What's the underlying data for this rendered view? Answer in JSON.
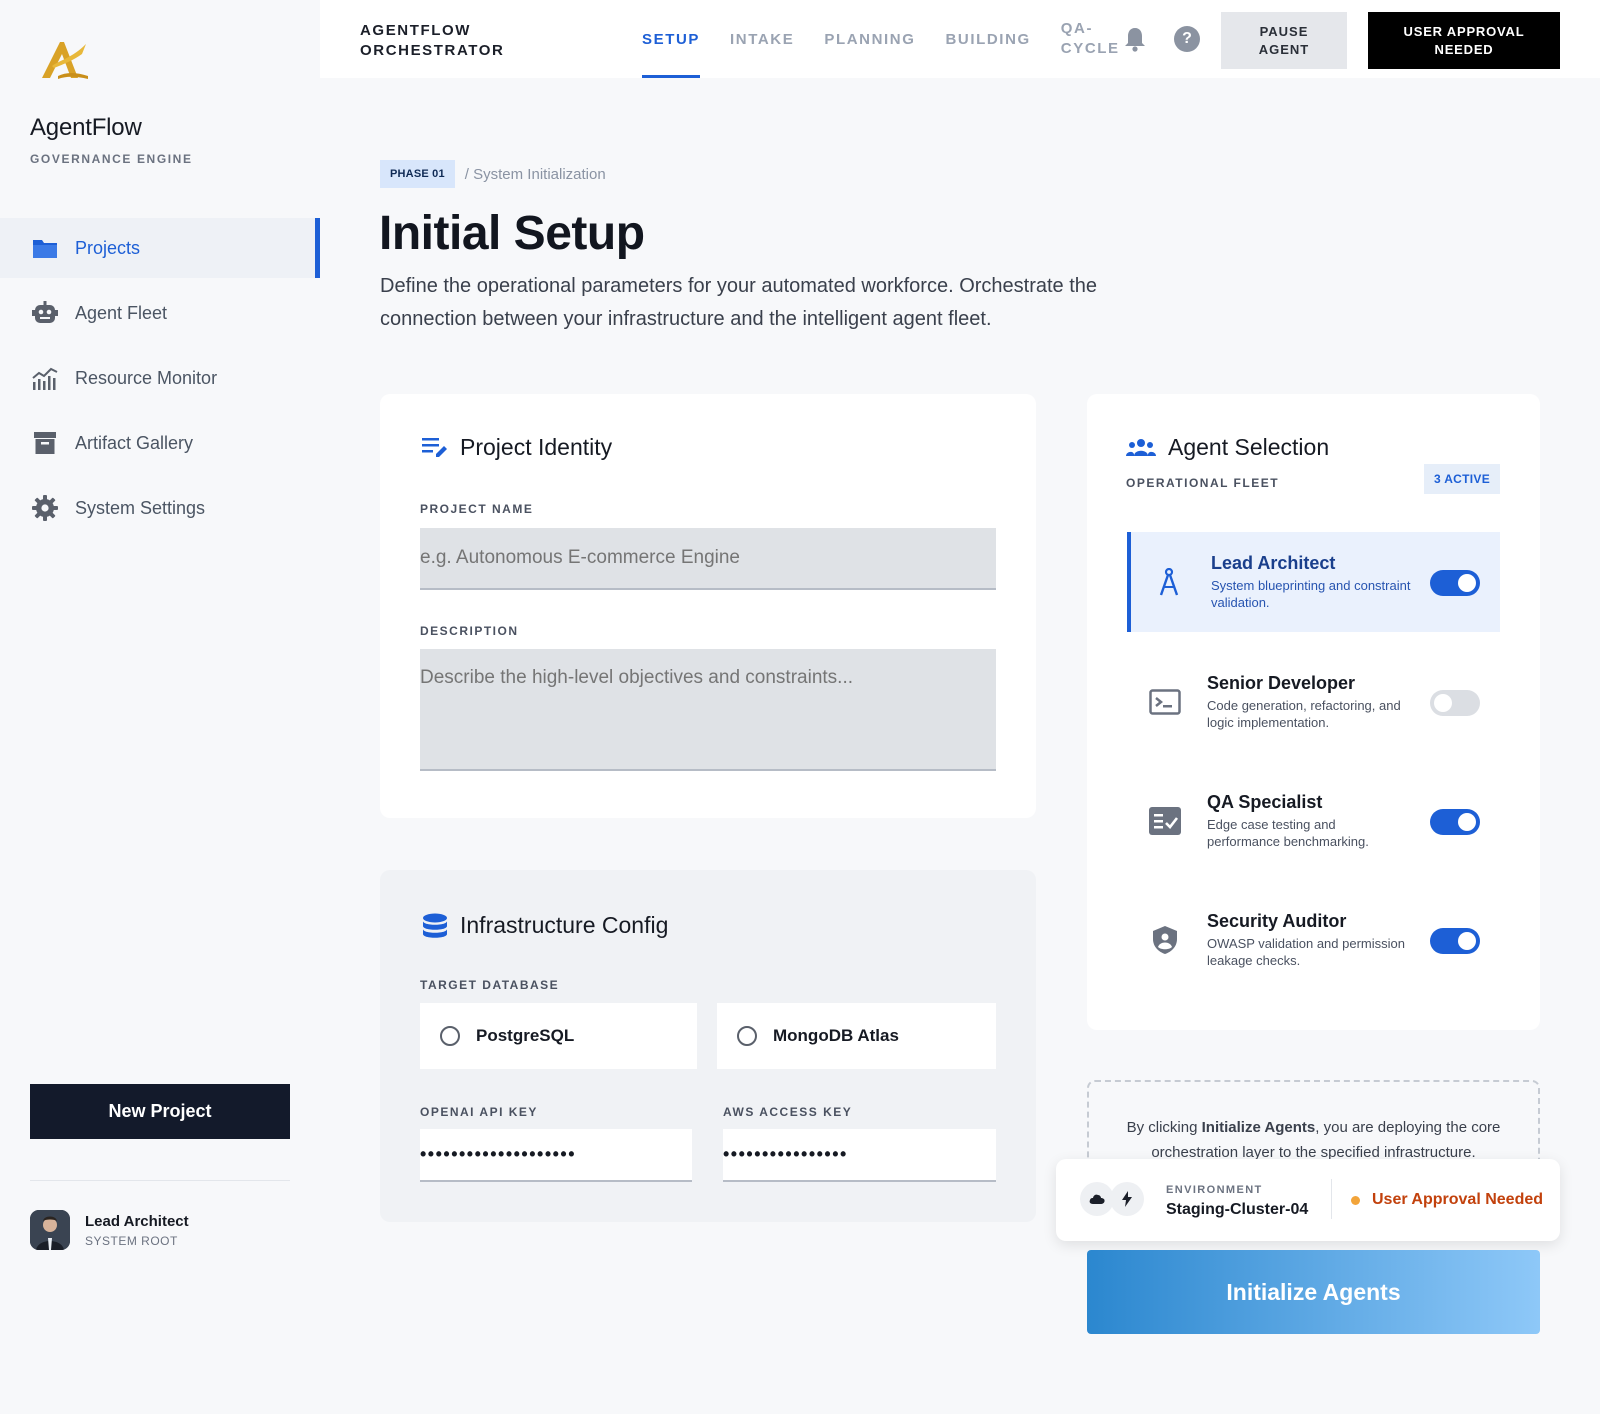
{
  "sidebar": {
    "brand_name": "AgentFlow",
    "brand_sub": "GOVERNANCE ENGINE",
    "items": [
      {
        "label": "Projects",
        "icon": "folder-icon"
      },
      {
        "label": "Agent Fleet",
        "icon": "robot-icon"
      },
      {
        "label": "Resource Monitor",
        "icon": "chart-icon"
      },
      {
        "label": "Artifact Gallery",
        "icon": "archive-icon"
      },
      {
        "label": "System Settings",
        "icon": "gear-icon"
      }
    ],
    "new_project": "New Project",
    "user": {
      "name": "Lead Architect",
      "role": "SYSTEM ROOT"
    }
  },
  "topbar": {
    "title_line1": "AGENTFLOW",
    "title_line2": "ORCHESTRATOR",
    "tabs": [
      "SETUP",
      "INTAKE",
      "PLANNING",
      "BUILDING"
    ],
    "qa_tab_line1": "QA-",
    "qa_tab_line2": "CYCLE",
    "pause_line1": "PAUSE",
    "pause_line2": "AGENT",
    "approval_line1": "USER APPROVAL",
    "approval_line2": "NEEDED"
  },
  "breadcrumb": {
    "phase": "PHASE 01",
    "rest": "/ System Initialization"
  },
  "page": {
    "title": "Initial Setup",
    "description": "Define the operational parameters for your automated workforce. Orchestrate the connection between your infrastructure and the intelligent agent fleet."
  },
  "identity": {
    "title": "Project Identity",
    "name_label": "PROJECT NAME",
    "name_placeholder": "e.g. Autonomous E-commerce Engine",
    "desc_label": "DESCRIPTION",
    "desc_placeholder": "Describe the high-level objectives and constraints..."
  },
  "infra": {
    "title": "Infrastructure Config",
    "db_label": "TARGET DATABASE",
    "db_options": [
      "PostgreSQL",
      "MongoDB Atlas"
    ],
    "openai_label": "OPENAI API KEY",
    "openai_value": "••••••••••••••••••••",
    "aws_label": "AWS ACCESS KEY",
    "aws_value": "••••••••••••••••"
  },
  "agents": {
    "title": "Agent Selection",
    "subtitle": "OPERATIONAL FLEET",
    "active_badge": "3 ACTIVE",
    "list": [
      {
        "name": "Lead Architect",
        "desc": "System blueprinting and constraint validation.",
        "enabled": true
      },
      {
        "name": "Senior Developer",
        "desc": "Code generation, refactoring, and logic implementation.",
        "enabled": false
      },
      {
        "name": "QA Specialist",
        "desc": "Edge case testing and performance benchmarking.",
        "enabled": true
      },
      {
        "name": "Security Auditor",
        "desc": "OWASP validation and permission leakage checks.",
        "enabled": true
      }
    ]
  },
  "notice": {
    "prefix": "By clicking ",
    "bold": "Initialize Agents",
    "suffix": ", you are deploying the core orchestration layer to the specified infrastructure."
  },
  "environment": {
    "label": "ENVIRONMENT",
    "value": "Staging-Cluster-04",
    "status": "User Approval Needed"
  },
  "init_button": "Initialize Agents",
  "colors": {
    "accent": "#1d5fd6",
    "warning": "#c2410c",
    "logo_gold": "#d9a227"
  }
}
